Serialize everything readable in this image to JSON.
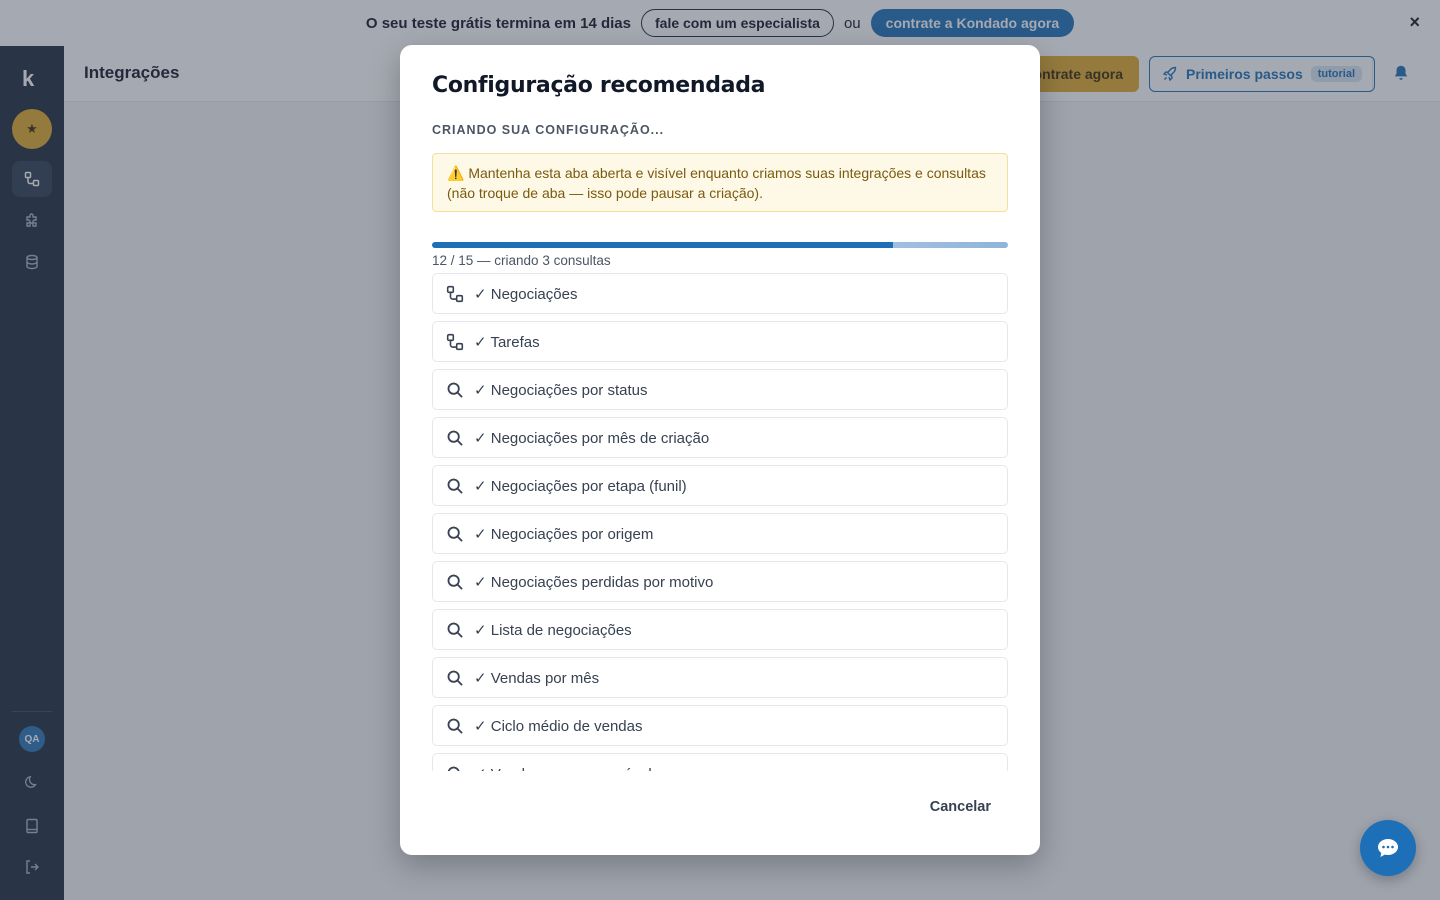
{
  "banner": {
    "text": "O seu teste grátis termina em 14 dias",
    "specialist_label": "fale com um especialista",
    "or_text": "ou",
    "cta_label": "contrate a Kondado agora",
    "close": "×"
  },
  "sidebar": {
    "logo": "k",
    "star": "★",
    "avatar": "QA"
  },
  "header": {
    "title": "Integrações",
    "cta_label": "ontrate agora",
    "start_label": "Primeiros passos",
    "tutorial_badge": "tutorial"
  },
  "modal": {
    "title": "Configuração recomendada",
    "subtitle": "CRIANDO SUA CONFIGURAÇÃO...",
    "alert": "⚠️ Mantenha esta aba aberta e visível enquanto criamos suas integrações e consultas (não troque de aba — isso pode pausar a criação).",
    "progress": {
      "done": 12,
      "total": 15,
      "fraction": 0.8
    },
    "progress_text": "12 / 15 — criando 3 consultas",
    "items": [
      {
        "icon": "integration",
        "label": "✓ Negociações"
      },
      {
        "icon": "integration",
        "label": "✓ Tarefas"
      },
      {
        "icon": "search",
        "label": "✓ Negociações por status"
      },
      {
        "icon": "search",
        "label": "✓ Negociações por mês de criação"
      },
      {
        "icon": "search",
        "label": "✓ Negociações por etapa (funil)"
      },
      {
        "icon": "search",
        "label": "✓ Negociações por origem"
      },
      {
        "icon": "search",
        "label": "✓ Negociações perdidas por motivo"
      },
      {
        "icon": "search",
        "label": "✓ Lista de negociações"
      },
      {
        "icon": "search",
        "label": "✓ Vendas por mês"
      },
      {
        "icon": "search",
        "label": "✓ Ciclo médio de vendas"
      },
      {
        "icon": "search",
        "label": "✓ Vendas por responsável"
      }
    ],
    "cancel_label": "Cancelar"
  }
}
